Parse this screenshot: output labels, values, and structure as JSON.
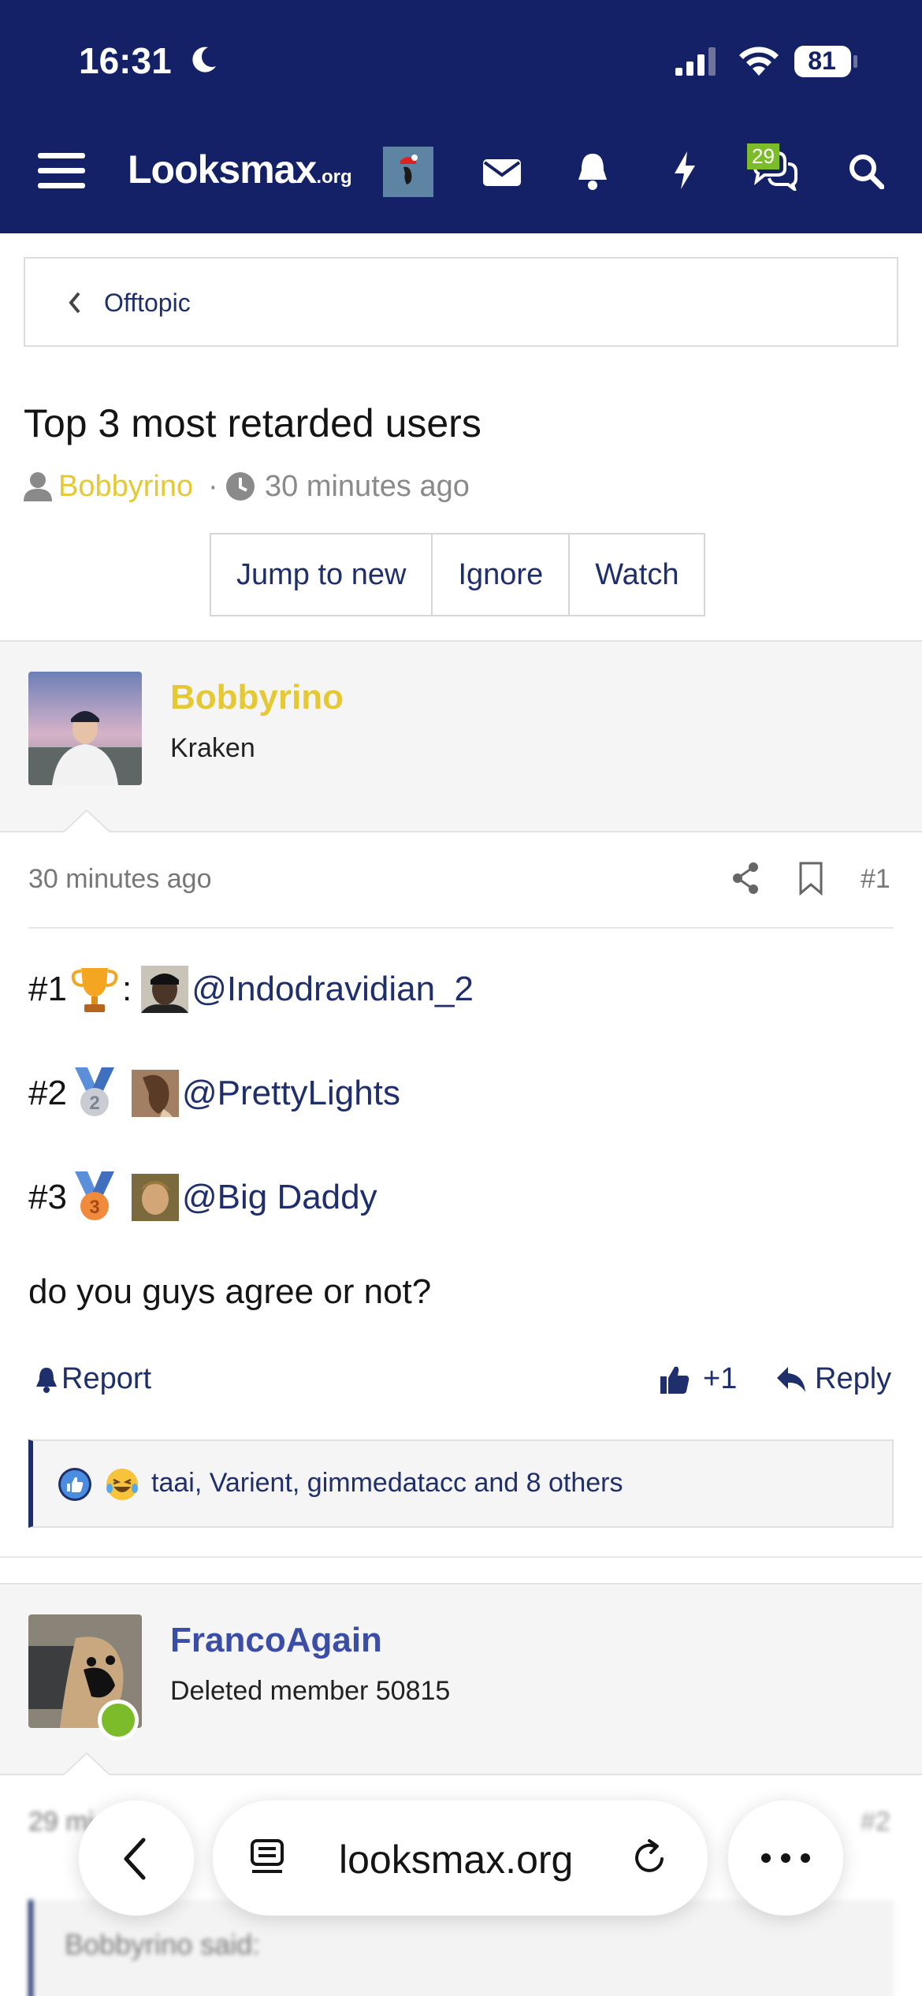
{
  "status_bar": {
    "time": "16:31",
    "battery": "81"
  },
  "nav": {
    "logo_main": "Looksmax",
    "logo_suffix": ".org",
    "conversations_badge": "29"
  },
  "breadcrumb": {
    "label": "Offtopic"
  },
  "thread": {
    "title": "Top 3 most retarded users",
    "author": "Bobbyrino",
    "separator": "·",
    "time": "30 minutes ago",
    "buttons": [
      "Jump to new",
      "Ignore",
      "Watch"
    ]
  },
  "post1": {
    "username": "Bobbyrino",
    "user_title": "Kraken",
    "date": "30 minutes ago",
    "number": "#1",
    "rankings": [
      {
        "rank": "#1",
        "suffix": ":",
        "mention": "@Indodravidian_2"
      },
      {
        "rank": "#2",
        "suffix": "",
        "mention": "@PrettyLights"
      },
      {
        "rank": "#3",
        "suffix": "",
        "mention": "@Big Daddy"
      }
    ],
    "question": "do you guys agree or not?",
    "report_label": "Report",
    "like_label": "+1",
    "reply_label": "Reply",
    "reactions_text": "taai, Varient, gimmedatacc and 8 others"
  },
  "post2": {
    "username": "FrancoAgain",
    "user_title": "Deleted member 50815",
    "date_partial": "29 mi      ago",
    "number": "#2",
    "quote_partial": "Bobbyrino said:"
  },
  "safari": {
    "url": "looksmax.org"
  },
  "colors": {
    "header_bg": "#142166",
    "link": "#1f2f6b",
    "author_gold": "#e6c832",
    "username_blue": "#3b4ea7",
    "online_green": "#7cbc2a"
  }
}
